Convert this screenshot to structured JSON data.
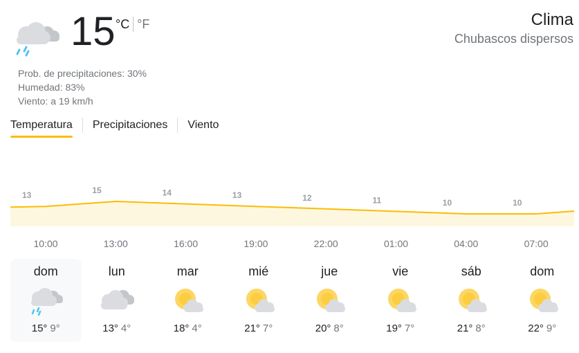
{
  "current": {
    "icon": "rain-cloud-icon",
    "temperature": "15",
    "unit_c": "°C",
    "unit_f": "°F",
    "precipitation": "Prob. de precipitaciones: 30%",
    "humidity": "Humedad: 83%",
    "wind": "Viento: a 19 km/h"
  },
  "header": {
    "title": "Clima",
    "condition": "Chubascos dispersos"
  },
  "tabs": [
    {
      "label": "Temperatura",
      "active": true
    },
    {
      "label": "Precipitaciones",
      "active": false
    },
    {
      "label": "Viento",
      "active": false
    }
  ],
  "colors": {
    "accent": "#fbbc04",
    "fill": "#fef7e0",
    "text": "#202124",
    "muted": "#70757a"
  },
  "chart_data": {
    "type": "area",
    "series": [
      {
        "values": [
          13,
          15,
          14,
          13,
          12,
          11,
          10,
          10
        ]
      }
    ],
    "point_labels": [
      "13",
      "15",
      "14",
      "13",
      "12",
      "11",
      "10",
      "10"
    ],
    "categories": [
      "10:00",
      "13:00",
      "16:00",
      "19:00",
      "22:00",
      "01:00",
      "04:00",
      "07:00"
    ],
    "grid": false
  },
  "days": [
    {
      "name": "dom",
      "icon": "rain-cloud-icon",
      "high": "15°",
      "low": "9°",
      "selected": true
    },
    {
      "name": "lun",
      "icon": "cloud-icon",
      "high": "13°",
      "low": "4°",
      "selected": false
    },
    {
      "name": "mar",
      "icon": "partly-cloudy-icon",
      "high": "18°",
      "low": "4°",
      "selected": false
    },
    {
      "name": "mié",
      "icon": "partly-cloudy-icon",
      "high": "21°",
      "low": "7°",
      "selected": false
    },
    {
      "name": "jue",
      "icon": "partly-cloudy-icon",
      "high": "20°",
      "low": "8°",
      "selected": false
    },
    {
      "name": "vie",
      "icon": "partly-cloudy-icon",
      "high": "19°",
      "low": "7°",
      "selected": false
    },
    {
      "name": "sáb",
      "icon": "partly-cloudy-icon",
      "high": "21°",
      "low": "8°",
      "selected": false
    },
    {
      "name": "dom",
      "icon": "partly-cloudy-icon",
      "high": "22°",
      "low": "9°",
      "selected": false
    }
  ]
}
